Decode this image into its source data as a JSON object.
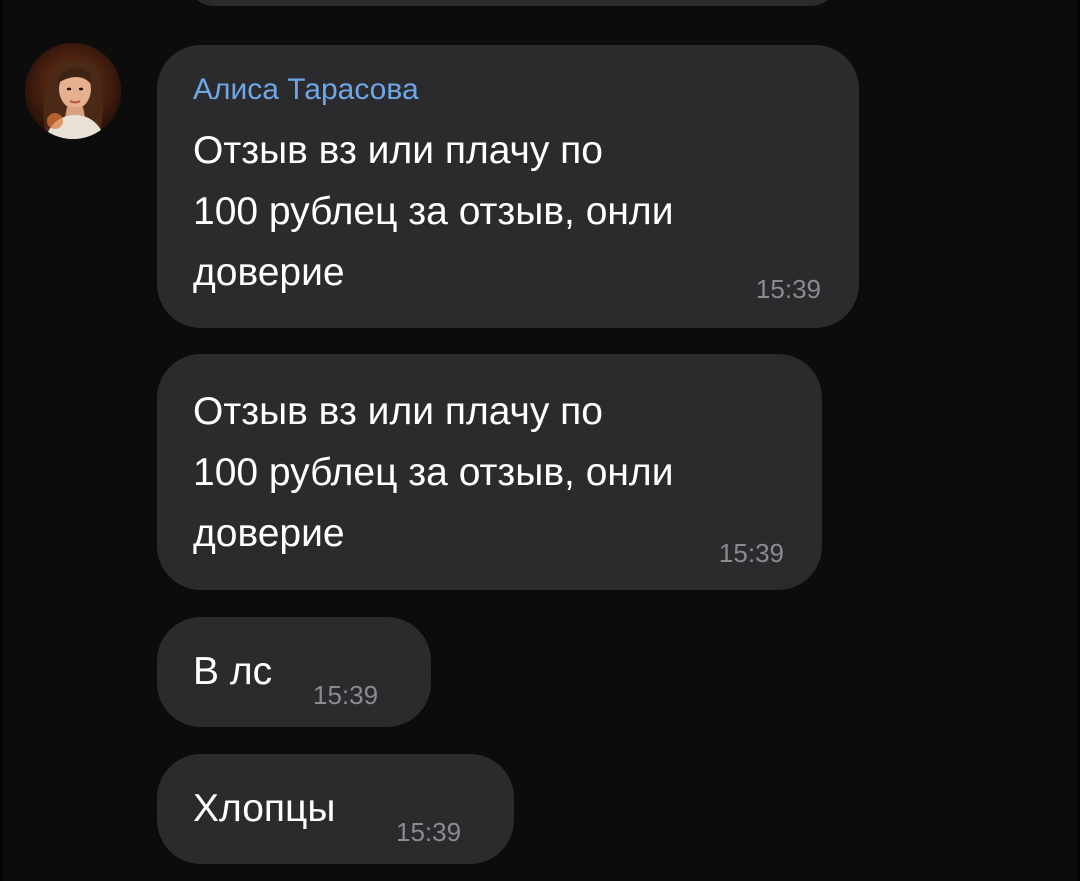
{
  "chat": {
    "sender_name": "Алиса Тарасова",
    "messages": [
      {
        "text": "Отзыв вз или плачу по\n100 рублец за отзыв, онли\nдоверие",
        "time": "15:39"
      },
      {
        "text": "Отзыв вз или плачу по\n100 рублец за отзыв, онли\nдоверие",
        "time": "15:39"
      },
      {
        "text": "В лс",
        "time": "15:39"
      },
      {
        "text": "Хлопцы",
        "time": "15:39"
      }
    ]
  },
  "colors": {
    "background": "#0c0c0d",
    "bubble": "#2b2b2e",
    "sender_name": "#6ea6e6",
    "timestamp": "#8a8a8f",
    "message_text": "#ffffff"
  },
  "icons": {
    "avatar": "user-avatar-photo"
  }
}
